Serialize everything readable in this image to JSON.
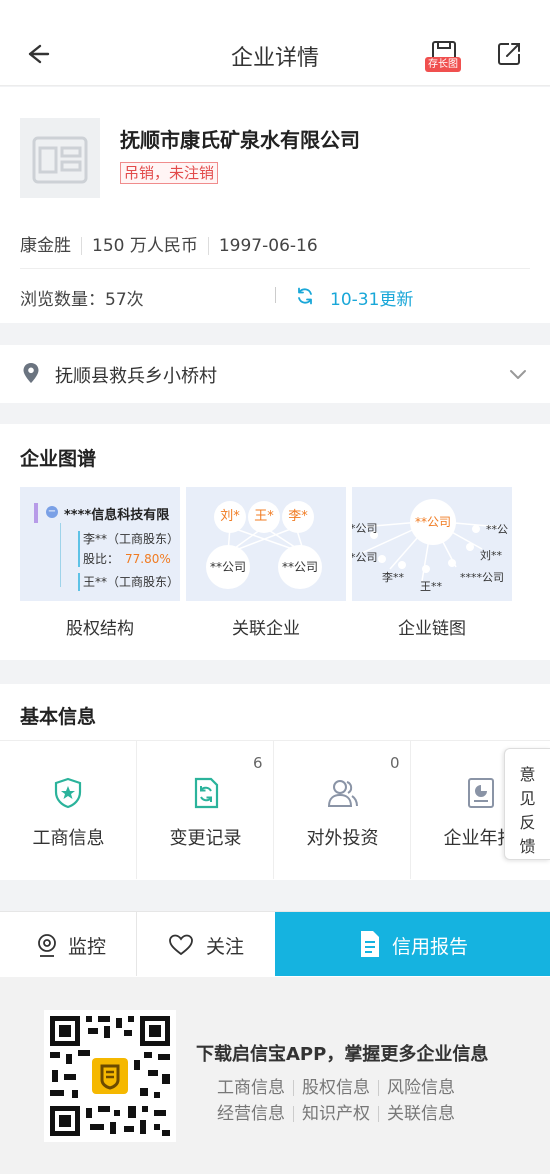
{
  "header": {
    "title": "企业详情",
    "save_tag": "存长图"
  },
  "company": {
    "name": "抚顺市康氏矿泉水有限公司",
    "status": "吊销，未注销",
    "legal_rep": "康金胜",
    "capital": "150 万人民币",
    "founded": "1997-06-16",
    "views_label": "浏览数量：57次",
    "update_label": "10-31更新"
  },
  "address": "抚顺县救兵乡小桥村",
  "graph": {
    "title": "企业图谱",
    "cards": [
      {
        "label": "股权结构",
        "company": "****信息科技有限",
        "row1": "李**（工商股东）",
        "ratio_label": "股比：",
        "ratio": "77.80%",
        "row2": "王**（工商股东）"
      },
      {
        "label": "关联企业",
        "persons": [
          "刘*",
          "王*",
          "李*"
        ],
        "companies": [
          "**公司",
          "**公司"
        ]
      },
      {
        "label": "企业链图",
        "center": "**公司",
        "nodes": [
          "*公司",
          "*公司",
          "李**",
          "王**",
          "****公司",
          "刘**",
          "**公"
        ]
      }
    ]
  },
  "basic": {
    "title": "基本信息",
    "items": [
      {
        "label": "工商信息",
        "count": ""
      },
      {
        "label": "变更记录",
        "count": "6"
      },
      {
        "label": "对外投资",
        "count": "0"
      },
      {
        "label": "企业年报",
        "count": ""
      }
    ]
  },
  "feedback": {
    "l1": "意",
    "l2": "见",
    "l3": "反",
    "l4": "馈"
  },
  "bottom_bar": {
    "monitor": "监控",
    "follow": "关注",
    "report": "信用报告"
  },
  "promo": {
    "title": "下载启信宝APP，掌握更多企业信息",
    "row1": [
      "工商信息",
      "股权信息",
      "风险信息"
    ],
    "row2": [
      "经营信息",
      "知识产权",
      "关联信息"
    ]
  },
  "colors": {
    "accent": "#15b3e0",
    "danger": "#e24b4b",
    "orange": "#f07b22",
    "teal": "#2bb39b"
  }
}
